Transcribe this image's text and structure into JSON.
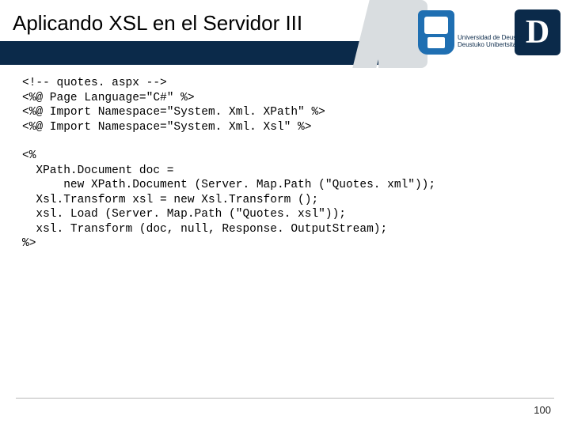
{
  "header": {
    "title": "Aplicando XSL en el Servidor III",
    "logo": {
      "letter": "D",
      "uni_line1": "Universidad de Deusto",
      "uni_line2": "Deustuko Unibertsitatea"
    }
  },
  "code": {
    "block1": "<!-- quotes. aspx -->\n<%@ Page Language=\"C#\" %>\n<%@ Import Namespace=\"System. Xml. XPath\" %>\n<%@ Import Namespace=\"System. Xml. Xsl\" %>",
    "block2": "<%\n  XPath.Document doc =\n      new XPath.Document (Server. Map.Path (\"Quotes. xml\"));\n  Xsl.Transform xsl = new Xsl.Transform ();\n  xsl. Load (Server. Map.Path (\"Quotes. xsl\"));\n  xsl. Transform (doc, null, Response. OutputStream);\n%>"
  },
  "page_number": "100"
}
